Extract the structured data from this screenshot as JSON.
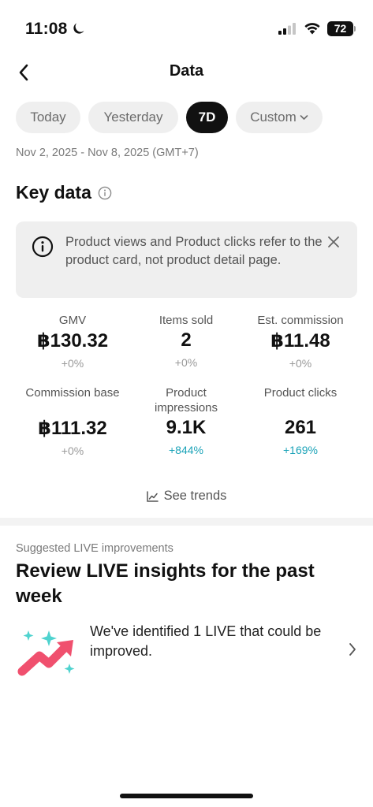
{
  "status_bar": {
    "time": "11:08",
    "battery": "72",
    "icons": [
      "moon-icon",
      "signal-icon",
      "wifi-icon",
      "battery-icon"
    ]
  },
  "nav": {
    "title": "Data",
    "back_icon": "chevron-left-icon"
  },
  "filters": {
    "today": "Today",
    "yesterday": "Yesterday",
    "seven_day": "7D",
    "custom": "Custom",
    "selected": "7D"
  },
  "date_range": "Nov 2, 2025 - Nov 8, 2025 (GMT+7)",
  "key_data": {
    "title": "Key data",
    "notice": "Product views and Product clicks refer to the product card, not product detail page."
  },
  "metrics": [
    {
      "label": "GMV",
      "value": "฿130.32",
      "change": "+0%"
    },
    {
      "label": "Items sold",
      "value": "2",
      "change": "+0%"
    },
    {
      "label": "Est. commission",
      "value": "฿11.48",
      "change": "+0%"
    },
    {
      "label": "Commission base",
      "value": "฿111.32",
      "change": "+0%"
    },
    {
      "label": "Product impressions",
      "value": "9.1K",
      "change": "+844%"
    },
    {
      "label": "Product clicks",
      "value": "261",
      "change": "+169%"
    }
  ],
  "see_trends": "See trends",
  "suggestions": {
    "label": "Suggested LIVE improvements",
    "title": "Review LIVE insights for the past week",
    "item_text": "We've identified 1 LIVE that could be improved."
  },
  "colors": {
    "accent_positive": "#1ba3b8",
    "active_chip": "#111111",
    "chip_bg": "#efefef",
    "illustration_pink": "#f0506e",
    "illustration_teal": "#4fd3cf"
  }
}
